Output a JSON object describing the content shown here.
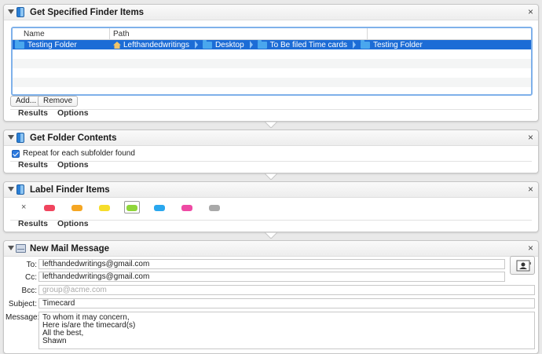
{
  "colors": {
    "selection": "#1c6cd6",
    "accent": "#2b7ae0"
  },
  "get_specified": {
    "title": "Get Specified Finder Items",
    "columns": [
      "Name",
      "Path"
    ],
    "rows": [
      {
        "name": "Testing Folder",
        "path": [
          "Lefthandedwritings",
          "Desktop",
          "To Be filed Time cards",
          "Testing Folder"
        ]
      }
    ],
    "add_label": "Add...",
    "remove_label": "Remove",
    "tabs": [
      "Results",
      "Options"
    ]
  },
  "get_folder": {
    "title": "Get Folder Contents",
    "repeat_label": "Repeat for each subfolder found",
    "repeat_checked": true,
    "tabs": [
      "Results",
      "Options"
    ]
  },
  "label_finder": {
    "title": "Label Finder Items",
    "clear_symbol": "×",
    "colors": [
      {
        "name": "red",
        "hex": "#f0455e"
      },
      {
        "name": "orange",
        "hex": "#f5a623"
      },
      {
        "name": "yellow",
        "hex": "#f6dd2b"
      },
      {
        "name": "green",
        "hex": "#8fd53a"
      },
      {
        "name": "blue",
        "hex": "#2aa7ee"
      },
      {
        "name": "purple",
        "hex": "#ee4aa4"
      },
      {
        "name": "gray",
        "hex": "#a9a9a9"
      }
    ],
    "selected": "green",
    "tabs": [
      "Results",
      "Options"
    ]
  },
  "mail": {
    "title": "New Mail Message",
    "to_label": "To:",
    "to_value": "lefthandedwritings@gmail.com",
    "cc_label": "Cc:",
    "cc_value": "lefthandedwritings@gmail.com",
    "bcc_label": "Bcc:",
    "bcc_placeholder": "group@acme.com",
    "subject_label": "Subject:",
    "subject_value": "Timecard",
    "message_label": "Message:",
    "message_value": "To whom it may concern,\nHere is/are the timecard(s)\nAll the best,\nShawn"
  },
  "close_symbol": "×"
}
